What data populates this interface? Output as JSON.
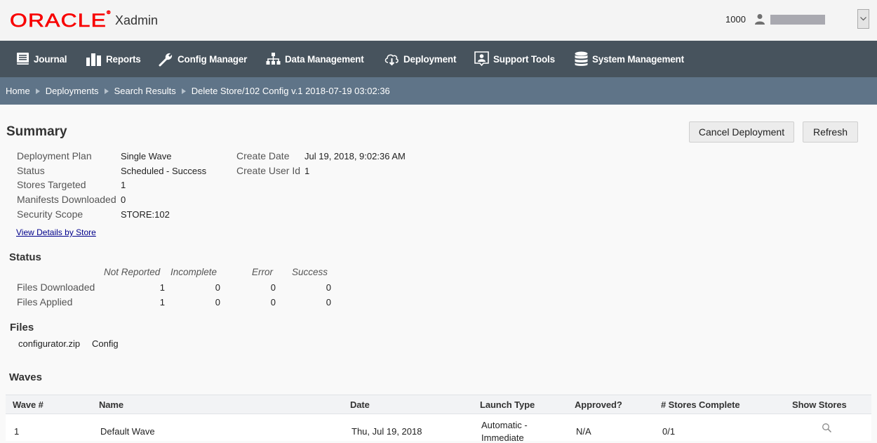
{
  "header": {
    "brand": "ORACLE",
    "brand_mark": "®",
    "app_name": "Xadmin",
    "store_number": "1000",
    "username_redacted": ""
  },
  "nav": {
    "items": [
      {
        "label": "Journal",
        "icon": "book-icon"
      },
      {
        "label": "Reports",
        "icon": "bar-chart-icon"
      },
      {
        "label": "Config Manager",
        "icon": "wrench-icon"
      },
      {
        "label": "Data Management",
        "icon": "hierarchy-icon"
      },
      {
        "label": "Deployment",
        "icon": "cloud-download-icon"
      },
      {
        "label": "Support Tools",
        "icon": "support-user-icon"
      },
      {
        "label": "System Management",
        "icon": "database-icon"
      }
    ]
  },
  "breadcrumb": {
    "items": [
      "Home",
      "Deployments",
      "Search Results"
    ],
    "current": "Delete Store/102 Config v.1 2018-07-19 03:02:36"
  },
  "summary": {
    "title": "Summary",
    "cancel_label": "Cancel Deployment",
    "refresh_label": "Refresh",
    "left_fields": [
      {
        "label": "Deployment Plan",
        "value": "Single Wave"
      },
      {
        "label": "Status",
        "value": "Scheduled - Success"
      },
      {
        "label": "Stores Targeted",
        "value": "1"
      },
      {
        "label": "Manifests Downloaded",
        "value": "0"
      },
      {
        "label": "Security Scope",
        "value": "STORE:102"
      }
    ],
    "right_fields": [
      {
        "label": "Create Date",
        "value": "Jul 19, 2018, 9:02:36 AM"
      },
      {
        "label": "Create User Id",
        "value": "1"
      }
    ],
    "details_link": "View Details by Store"
  },
  "status": {
    "title": "Status",
    "columns": [
      "Not Reported",
      "Incomplete",
      "Error",
      "Success"
    ],
    "rows": [
      {
        "label": "Files Downloaded",
        "values": [
          "1",
          "0",
          "0",
          "0"
        ]
      },
      {
        "label": "Files Applied",
        "values": [
          "1",
          "0",
          "0",
          "0"
        ]
      }
    ]
  },
  "files": {
    "title": "Files",
    "items": [
      {
        "name": "configurator.zip",
        "type": "Config"
      }
    ]
  },
  "waves": {
    "title": "Waves",
    "columns": [
      "Wave #",
      "Name",
      "Date",
      "Launch Type",
      "Approved?",
      "# Stores Complete",
      "Show Stores"
    ],
    "rows": [
      {
        "wave": "1",
        "name": "Default Wave",
        "date": "Thu, Jul 19, 2018",
        "launch_line1": "Automatic -",
        "launch_line2": "Immediate",
        "approved": "N/A",
        "stores_complete": "0/1",
        "show_stores_icon": "search-icon"
      }
    ]
  },
  "colors": {
    "brand_red": "#f80000",
    "nav_bg": "#47535d",
    "breadcrumb_bg": "#5f7488",
    "link": "#00008b"
  }
}
